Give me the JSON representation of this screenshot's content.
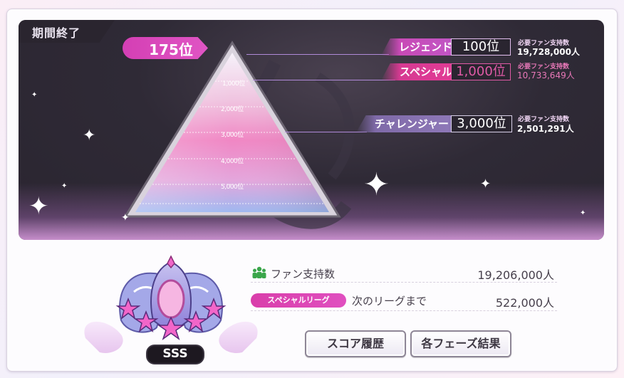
{
  "status": "期間終了",
  "current_rank": "175位",
  "leagues": [
    {
      "name": "レジェンド",
      "rank": "100位",
      "req_caption": "必要ファン支持数",
      "req_value": "19,728,000人",
      "color": "#d83cb3",
      "rank_color": "#ffffff"
    },
    {
      "name": "スペシャル",
      "rank": "1,000位",
      "req_caption": "必要ファン支持数",
      "req_value": "10,733,649人",
      "color": "#e23b95",
      "rank_color": "#e05aa6"
    },
    {
      "name": "チャレンジャー",
      "rank": "3,000位",
      "req_caption": "必要ファン支持数",
      "req_value": "2,501,291人",
      "color": "#9a7fc6",
      "rank_color": "#ffffff"
    }
  ],
  "scale_labels": [
    "1,000位",
    "2,000位",
    "3,000位",
    "4,000位",
    "5,000位"
  ],
  "grade": "SSS",
  "fan_support": {
    "label": "ファン支持数",
    "value": "19,206,000人",
    "icon": "people-icon"
  },
  "league_badge": "スペシャルリーグ",
  "next_league": {
    "label": "次のリーグまで",
    "value": "522,000人"
  },
  "buttons": {
    "score_history": "スコア履歴",
    "phase_results": "各フェーズ結果"
  }
}
